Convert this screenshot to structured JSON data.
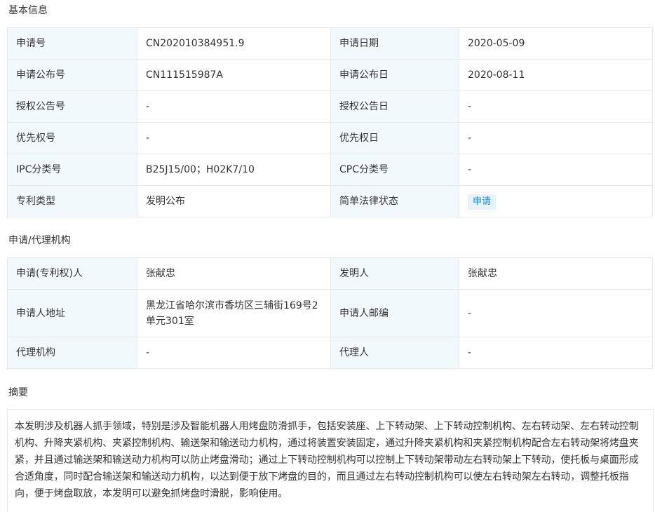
{
  "basic_info": {
    "title": "基本信息",
    "rows": [
      {
        "l1": "申请号",
        "v1": "CN202010384951.9",
        "l2": "申请日期",
        "v2": "2020-05-09"
      },
      {
        "l1": "申请公布号",
        "v1": "CN111515987A",
        "l2": "申请公布日",
        "v2": "2020-08-11"
      },
      {
        "l1": "授权公告号",
        "v1": "-",
        "l2": "授权公告日",
        "v2": "-"
      },
      {
        "l1": "优先权号",
        "v1": "-",
        "l2": "优先权日",
        "v2": "-"
      },
      {
        "l1": "IPC分类号",
        "v1": "B25J15/00；H02K7/10",
        "l2": "CPC分类号",
        "v2": "-"
      },
      {
        "l1": "专利类型",
        "v1": "发明公布",
        "l2": "简单法律状态",
        "v2": "申请"
      }
    ]
  },
  "agency": {
    "title": "申请/代理机构",
    "rows": [
      {
        "l1": "申请(专利权)人",
        "v1": "张献忠",
        "l2": "发明人",
        "v2": "张献忠"
      },
      {
        "l1": "申请人地址",
        "v1": "黑龙江省哈尔滨市香坊区三辅街169号2单元301室",
        "l2": "申请人邮编",
        "v2": "-"
      },
      {
        "l1": "代理机构",
        "v1": "-",
        "l2": "代理人",
        "v2": "-"
      }
    ]
  },
  "abstract": {
    "title": "摘要",
    "text": "本发明涉及机器人抓手领域，特别是涉及智能机器人用烤盘防滑抓手，包括安装座、上下转动架、上下转动控制机构、左右转动架、左右转动控制机构、升降夹紧机构、夹紧控制机构、输送架和输送动力机构，通过将装置安装固定，通过升降夹紧机构和夹紧控制机构配合左右转动架将烤盘夹紧，并且通过输送架和输送动力机构可以防止烤盘滑动；通过上下转动控制机构可以控制上下转动架带动左右转动架上下转动，使托板与桌面形成合适角度，同时配合输送架和输送动力机构，以达到便于放下烤盘的目的，而且通过左右转动控制机构可以使左右转动架左右转动，调整托板指向，便于烤盘取放，本发明可以避免抓烤盘时滑脱，影响使用。"
  },
  "colors": {
    "label_bg": "#f2f9fc",
    "border": "#e8e8e8",
    "badge_bg": "#e6f3fb",
    "badge_text": "#1a8ad4"
  }
}
